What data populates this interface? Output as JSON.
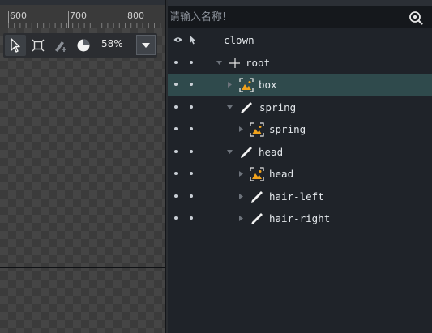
{
  "ruler": {
    "ticks": [
      "600",
      "700",
      "800"
    ]
  },
  "toolbar": {
    "zoom_value": "58%",
    "tools": [
      "select-arrow-icon",
      "bone-transform-icon",
      "weight-brush-icon",
      "pie-mode-icon"
    ]
  },
  "search": {
    "placeholder": "请输入名称!"
  },
  "tree": {
    "header": {
      "label": "clown"
    },
    "rows": [
      {
        "label": "root",
        "icon": "bone-icon",
        "arrow": "expanded",
        "selected": false
      },
      {
        "label": "box",
        "icon": "image-icon",
        "arrow": "collapsed",
        "selected": true
      },
      {
        "label": "spring",
        "icon": "slot-bone-icon",
        "arrow": "expanded",
        "selected": false
      },
      {
        "label": "spring",
        "icon": "image-icon",
        "arrow": "collapsed",
        "selected": false
      },
      {
        "label": "head",
        "icon": "slot-bone-icon",
        "arrow": "expanded",
        "selected": false
      },
      {
        "label": "head",
        "icon": "image-icon",
        "arrow": "collapsed",
        "selected": false
      },
      {
        "label": "hair-left",
        "icon": "slot-bone-icon",
        "arrow": "collapsed",
        "selected": false
      },
      {
        "label": "hair-right",
        "icon": "slot-bone-icon",
        "arrow": "collapsed",
        "selected": false
      }
    ]
  },
  "colors": {
    "selected_row": "#2f4a4c",
    "image_icon_accent": "#f0a21c"
  }
}
